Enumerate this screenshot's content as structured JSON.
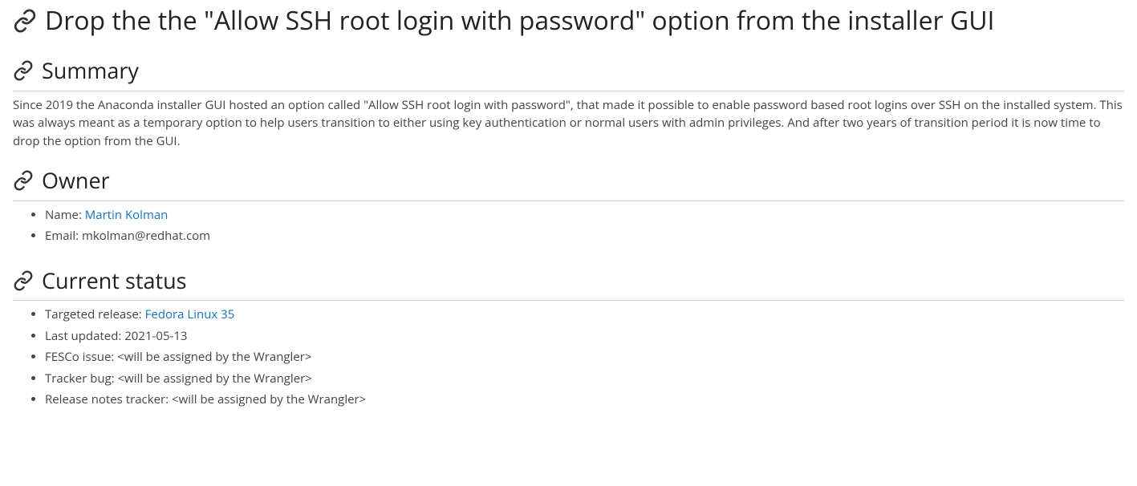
{
  "title": "Drop the the \"Allow SSH root login with password\" option from the installer GUI",
  "summary": {
    "heading": "Summary",
    "text": "Since 2019 the Anaconda installer GUI hosted an option called \"Allow SSH root login with password\", that made it possible to enable password based root logins over SSH on the installed system. This was always meant as a temporary option to help users transition to either using key authentication or normal users with admin privileges. And after two years of transition period it is now time to drop the option from the GUI."
  },
  "owner": {
    "heading": "Owner",
    "name_label": "Name: ",
    "name_link": "Martin Kolman",
    "email_label": "Email: mkolman@redhat.com"
  },
  "status": {
    "heading": "Current status",
    "targeted_label": "Targeted release: ",
    "targeted_link": "Fedora Linux 35",
    "last_updated": "Last updated: 2021-05-13",
    "fesco": "FESCo issue: <will be assigned by the Wrangler>",
    "tracker": "Tracker bug: <will be assigned by the Wrangler>",
    "release_notes": "Release notes tracker: <will be assigned by the Wrangler>"
  }
}
